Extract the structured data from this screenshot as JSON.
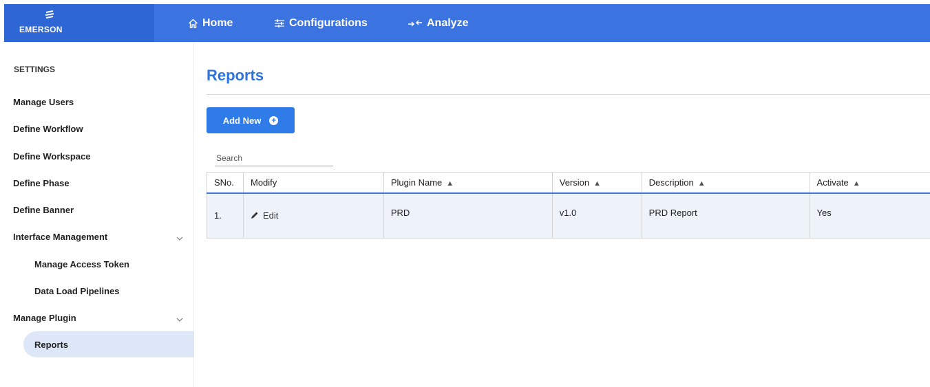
{
  "brand": {
    "name": "EMERSON"
  },
  "nav": [
    {
      "label": "Home",
      "icon": "home-icon"
    },
    {
      "label": "Configurations",
      "icon": "sliders-icon"
    },
    {
      "label": "Analyze",
      "icon": "analyze-icon"
    }
  ],
  "sidebar": {
    "header": "SETTINGS",
    "items": [
      {
        "label": "Manage Users"
      },
      {
        "label": "Define Workflow"
      },
      {
        "label": "Define Workspace"
      },
      {
        "label": "Define Phase"
      },
      {
        "label": "Define Banner"
      },
      {
        "label": "Interface Management",
        "expandable": true
      },
      {
        "label": "Manage Access Token",
        "sub": true
      },
      {
        "label": "Data Load Pipelines",
        "sub": true
      },
      {
        "label": "Manage Plugin",
        "expandable": true
      },
      {
        "label": "Reports",
        "sub": true,
        "active": true
      }
    ]
  },
  "main": {
    "title": "Reports",
    "add_button": "Add New",
    "search_placeholder": "Search",
    "table": {
      "columns": [
        "SNo.",
        "Modify",
        "Plugin Name",
        "Version",
        "Description",
        "Activate"
      ],
      "rows": [
        {
          "sno": "1.",
          "modify": "Edit",
          "plugin_name": "PRD",
          "version": "v1.0",
          "description": "PRD Report",
          "activate": "Yes"
        }
      ]
    }
  },
  "colors": {
    "topbar": "#3b73e0",
    "accent": "#2f7be8",
    "active_bg": "#dde7f7"
  }
}
